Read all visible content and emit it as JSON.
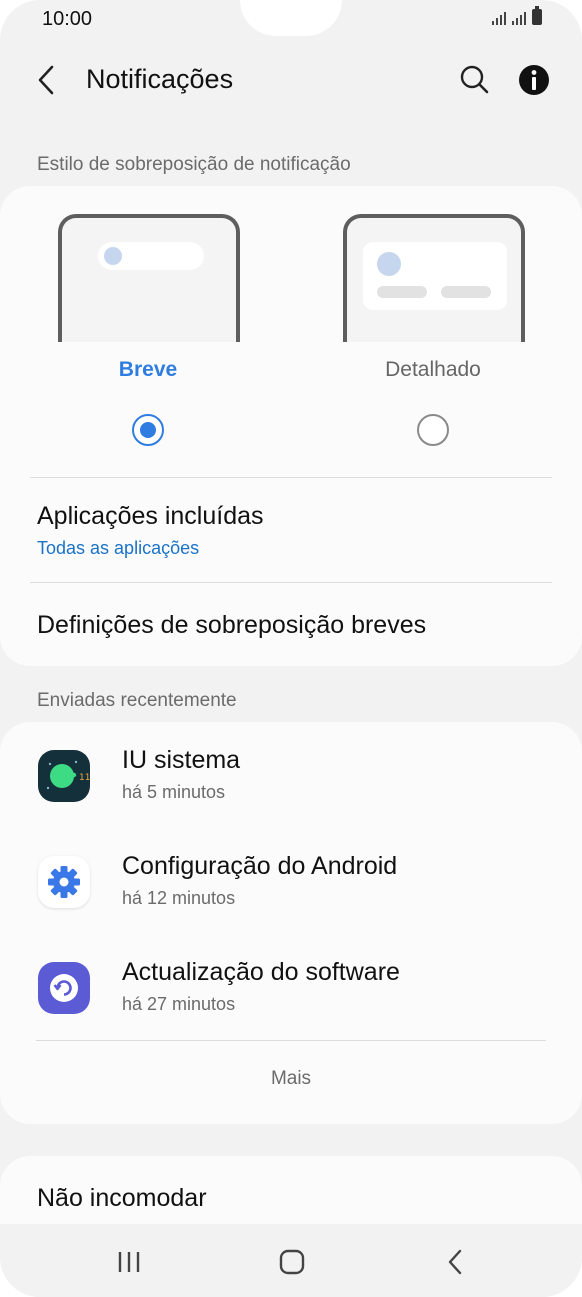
{
  "status_bar": {
    "time": "10:00"
  },
  "header": {
    "title": "Notificações"
  },
  "sections": {
    "overlay_style_label": "Estilo de sobreposição de notificação",
    "recent_label": "Enviadas recentemente"
  },
  "overlay_options": [
    {
      "label": "Breve",
      "selected": true
    },
    {
      "label": "Detalhado",
      "selected": false
    }
  ],
  "settings": {
    "included_apps_title": "Aplicações incluídas",
    "included_apps_value": "Todas as aplicações",
    "brief_settings_title": "Definições de sobreposição breves"
  },
  "recent_apps": [
    {
      "name": "IU sistema",
      "time": "há 5 minutos",
      "icon": "system-ui-icon"
    },
    {
      "name": "Configuração do Android",
      "time": "há 12 minutos",
      "icon": "gear-icon"
    },
    {
      "name": "Actualização do software",
      "time": "há 27 minutos",
      "icon": "software-update-icon"
    }
  ],
  "more_label": "Mais",
  "do_not_disturb": "Não incomodar",
  "colors": {
    "accent": "#2f7de1",
    "link": "#1a73c8",
    "background": "#f2f2f2",
    "card": "#fbfbfb"
  }
}
